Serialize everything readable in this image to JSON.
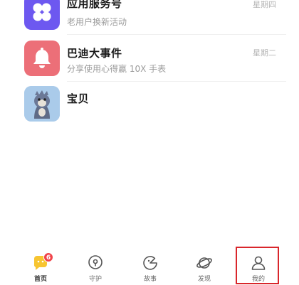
{
  "conversations": [
    {
      "title": "应用服务号",
      "subtitle": "老用户换新活动",
      "time": "星期四",
      "icon": "flower-icon",
      "color": "#6d58f0"
    },
    {
      "title": "巴迪大事件",
      "subtitle": "分享使用心得赢 10X 手表",
      "time": "星期二",
      "icon": "bell-icon",
      "color": "#ec6f78"
    },
    {
      "title": "宝贝",
      "subtitle": "",
      "time": "",
      "icon": "child-avatar",
      "color": "#aacbea"
    }
  ],
  "tabs": [
    {
      "label": "首页",
      "icon": "home-chat-icon",
      "badge": "6"
    },
    {
      "label": "守护",
      "icon": "location-pin-icon"
    },
    {
      "label": "故事",
      "icon": "story-icon"
    },
    {
      "label": "发现",
      "icon": "planet-icon"
    },
    {
      "label": "我的",
      "icon": "profile-icon"
    }
  ],
  "colors": {
    "accent_yellow": "#f7c531",
    "badge_red": "#f0444a",
    "highlight_red": "#d9262b"
  }
}
